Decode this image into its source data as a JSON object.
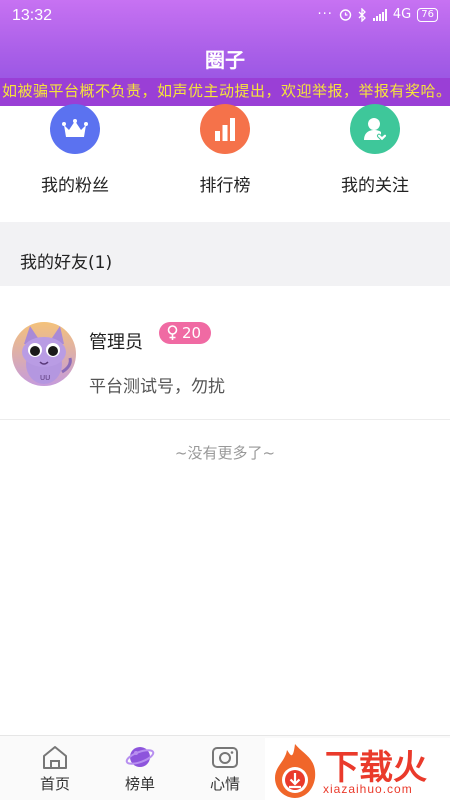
{
  "status_bar": {
    "time": "13:32",
    "network": "4G",
    "battery": "76",
    "icons": [
      "more-dots-icon",
      "alarm-icon",
      "bluetooth-icon",
      "signal-icon",
      "battery-icon"
    ]
  },
  "header": {
    "title": "圈子",
    "notice": "如被骗平台概不负责，如声优主动提出，欢迎举报，举报有奖哈。"
  },
  "quick_actions": [
    {
      "label": "我的粉丝",
      "icon": "crown-icon",
      "color": "#5b72f0"
    },
    {
      "label": "排行榜",
      "icon": "bar-chart-icon",
      "color": "#f5724a"
    },
    {
      "label": "我的关注",
      "icon": "user-heart-icon",
      "color": "#3ec79a"
    }
  ],
  "friends_section": {
    "title": "我的好友(1)"
  },
  "friends": [
    {
      "name": "管理员",
      "badge_gender": "female",
      "badge_value": "20",
      "signature": "平台测试号，勿扰"
    }
  ],
  "list_end": "~没有更多了~",
  "bottom_nav": [
    {
      "label": "首页",
      "icon": "home-icon",
      "active": false
    },
    {
      "label": "榜单",
      "icon": "planet-icon",
      "active": true
    },
    {
      "label": "心情",
      "icon": "camera-icon",
      "active": false
    }
  ],
  "watermark": {
    "text": "下载火",
    "sub": "xiazaihuo.com"
  },
  "colors": {
    "header_start": "#c772f2",
    "header_end": "#8e4fe0",
    "notice_text": "#f6e43a",
    "badge": "#f06aa3",
    "watermark": "#ea3a2b"
  }
}
